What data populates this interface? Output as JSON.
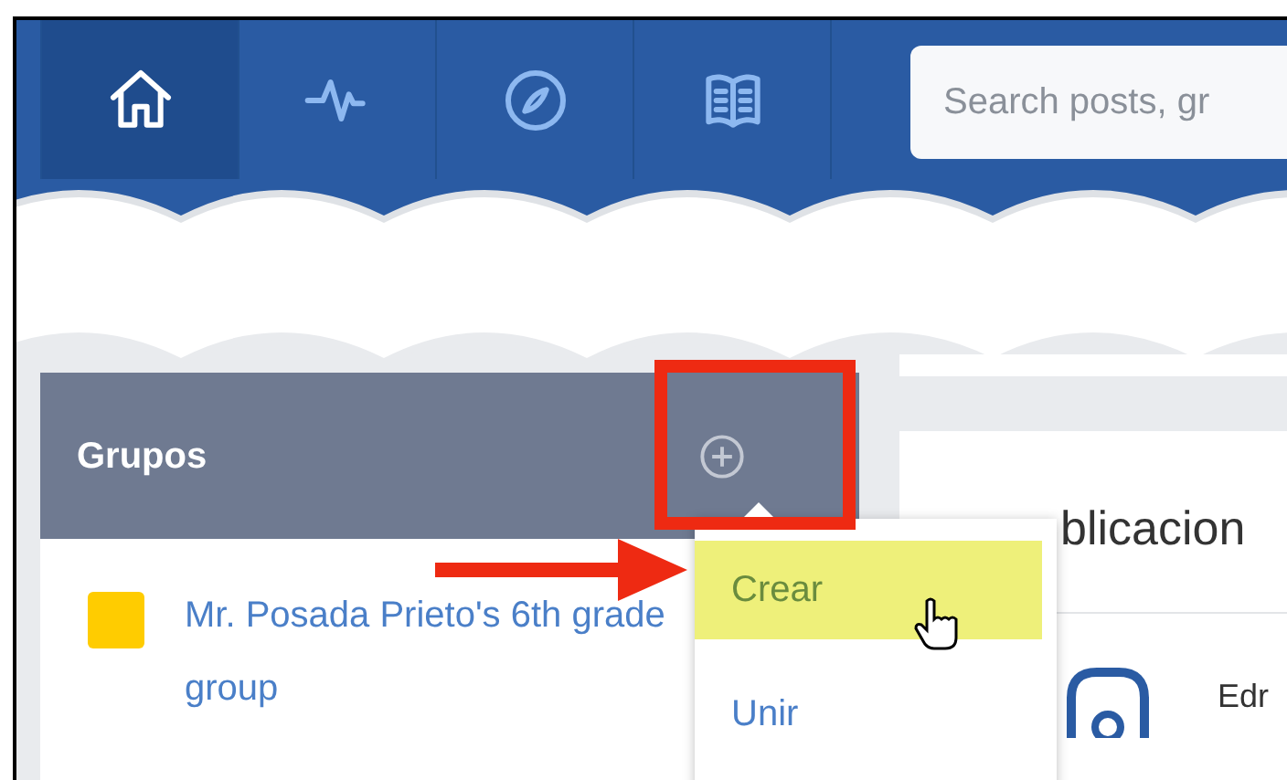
{
  "nav": {
    "tabs": [
      {
        "kind": "home",
        "selected": true
      },
      {
        "kind": "activity",
        "selected": false
      },
      {
        "kind": "compass",
        "selected": false
      },
      {
        "kind": "book",
        "selected": false
      }
    ],
    "search": {
      "placeholder": "Search posts, gr"
    }
  },
  "groups_panel": {
    "title": "Grupos",
    "groups": [
      {
        "name": "Mr. Posada Prieto's 6th grade group",
        "color": "#ffcc00"
      }
    ]
  },
  "add_menu": {
    "items": [
      {
        "label": "Crear",
        "selected": true
      },
      {
        "label": "Unir",
        "selected": false
      }
    ]
  },
  "feed": {
    "title": "blicacion",
    "post_author": "Edr"
  }
}
